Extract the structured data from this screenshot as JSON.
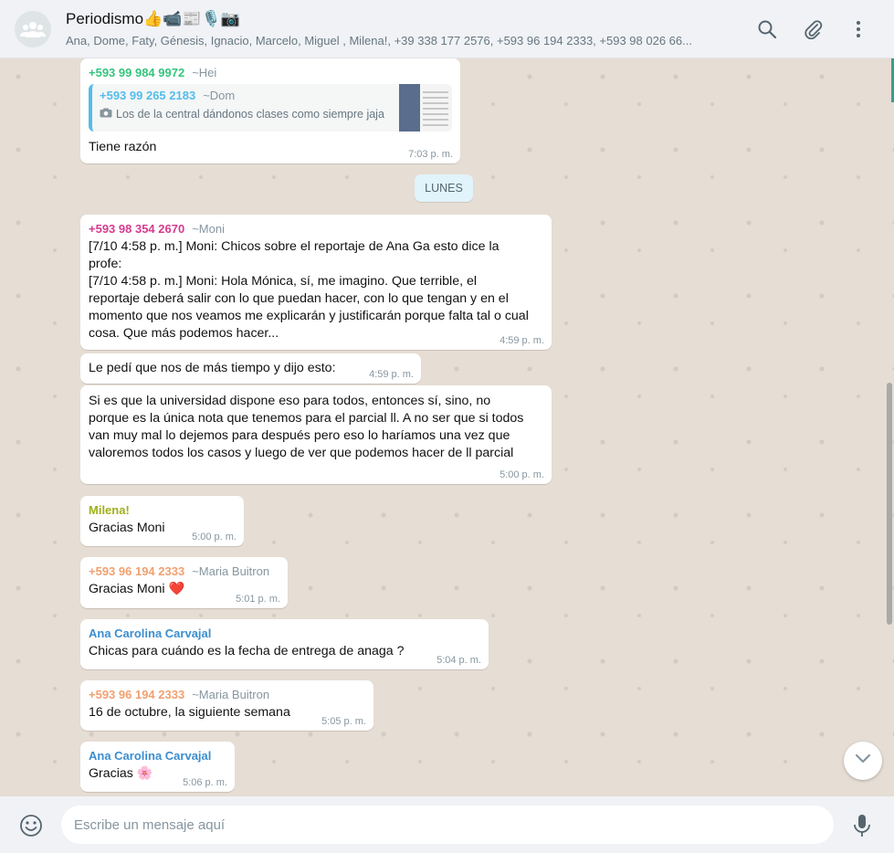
{
  "header": {
    "title": "Periodismo👍📹📰🎙️📷",
    "members": "Ana, Dome, Faty, Génesis, Ignacio, Marcelo, Miguel , Milena!, +39 338 177 2576, +593 96 194 2333, +593 98 026 66..."
  },
  "day_separator": "LUNES",
  "messages": [
    {
      "sender": "+593 99 984 9972",
      "alias": "~Hei",
      "sender_color": "#35c47c",
      "quote": {
        "name": "+593 99 265 2183",
        "alias": "~Dom",
        "text": "Los de la central dándonos clases como siempre jaja"
      },
      "text": "Tiene razón",
      "time": "7:03 p. m."
    },
    {
      "sender": "+593 98 354 2670",
      "alias": "~Moni",
      "sender_color": "#d63b8f",
      "lines": [
        "[7/10 4:58 p. m.] Moni: Chicos sobre el reportaje de Ana Ga esto dice la",
        "profe:",
        "[7/10 4:58 p. m.] Moni: Hola Mónica, sí, me imagino. Que terrible, el",
        "reportaje deberá salir con lo que puedan hacer, con lo que tengan y en el",
        "momento que nos veamos me explicarán y justificarán porque falta tal o cual",
        "cosa. Que más podemos hacer..."
      ],
      "time": "4:59 p. m."
    },
    {
      "text": "Le pedí que nos de más tiempo y dijo esto:",
      "time": "4:59 p. m."
    },
    {
      "lines": [
        "Si es que la universidad dispone eso para todos, entonces sí, sino, no",
        "porque es la única nota que tenemos para el parcial ll. A no ser que si todos",
        "van muy mal lo dejemos para después pero eso lo haríamos una vez que",
        "valoremos todos los casos y luego de ver que podemos hacer de ll parcial"
      ],
      "time": "5:00 p. m."
    },
    {
      "sender": "Milena!",
      "sender_color": "#9fb018",
      "text": "Gracias Moni",
      "time": "5:00 p. m."
    },
    {
      "sender": "+593 96 194 2333",
      "alias": "~Maria Buitron",
      "sender_color": "#f0a070",
      "text": "Gracias Moni",
      "emoji": "❤️",
      "time": "5:01 p. m."
    },
    {
      "sender": "Ana Carolina Carvajal",
      "sender_color": "#3b8ed0",
      "text": "Chicas para cuándo es la fecha de entrega de anaga ?",
      "time": "5:04 p. m."
    },
    {
      "sender": "+593 96 194 2333",
      "alias": "~Maria Buitron",
      "sender_color": "#f0a070",
      "text": "16 de octubre, la siguiente semana",
      "time": "5:05 p. m."
    },
    {
      "sender": "Ana Carolina Carvajal",
      "sender_color": "#3b8ed0",
      "text": "Gracias",
      "emoji": "🌸",
      "time": "5:06 p. m."
    }
  ],
  "composer": {
    "placeholder": "Escribe un mensaje aquí"
  },
  "icons": [
    "group-avatar-icon",
    "search-icon",
    "attach-icon",
    "menu-icon",
    "emoji-icon",
    "mic-icon",
    "chevron-down-icon",
    "camera-icon"
  ]
}
